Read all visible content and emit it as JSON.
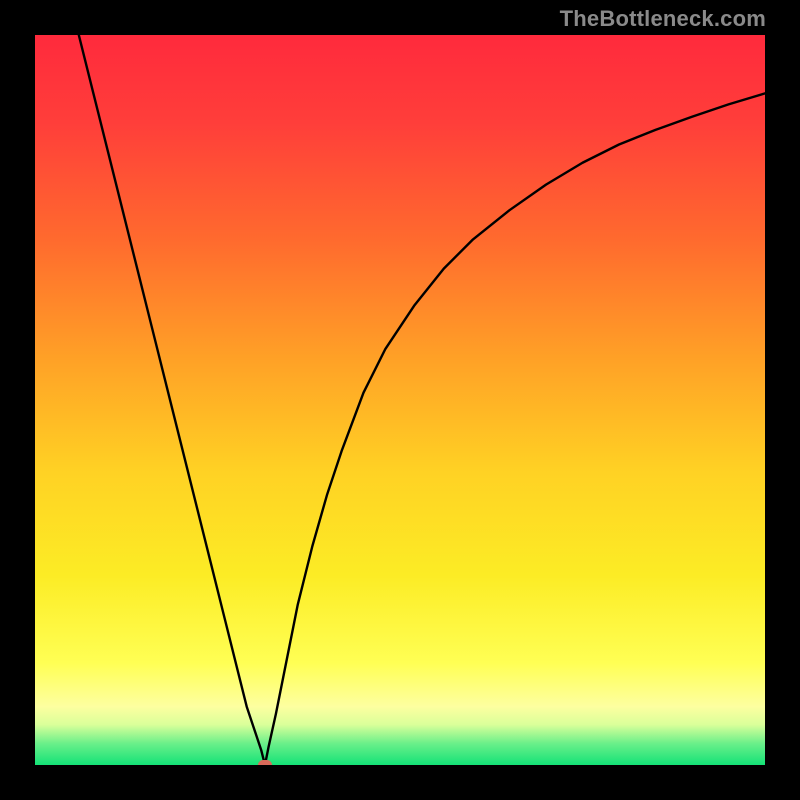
{
  "watermark": "TheBottleneck.com",
  "colors": {
    "background": "#000000",
    "gradient_stops": [
      {
        "offset": 0.0,
        "color": "#ff2a3c"
      },
      {
        "offset": 0.12,
        "color": "#ff3e3a"
      },
      {
        "offset": 0.28,
        "color": "#ff6a2e"
      },
      {
        "offset": 0.45,
        "color": "#ffa326"
      },
      {
        "offset": 0.6,
        "color": "#ffd224"
      },
      {
        "offset": 0.74,
        "color": "#fcec25"
      },
      {
        "offset": 0.86,
        "color": "#ffff54"
      },
      {
        "offset": 0.92,
        "color": "#fdffa0"
      },
      {
        "offset": 0.945,
        "color": "#d9ff9a"
      },
      {
        "offset": 0.97,
        "color": "#6cf08a"
      },
      {
        "offset": 1.0,
        "color": "#14e277"
      }
    ],
    "curve": "#000000",
    "marker": "#d86a5a"
  },
  "chart_data": {
    "type": "line",
    "title": "",
    "xlabel": "",
    "ylabel": "",
    "x_range": [
      0,
      100
    ],
    "y_range": [
      0,
      100
    ],
    "marker": {
      "x": 31.5,
      "y": 0,
      "shape": "rounded-rect"
    },
    "series": [
      {
        "name": "bottleneck-curve",
        "x": [
          6,
          8,
          10,
          12,
          14,
          16,
          18,
          20,
          22,
          24,
          26,
          28,
          29,
          30,
          31,
          31.5,
          32,
          33,
          34,
          36,
          38,
          40,
          42,
          45,
          48,
          52,
          56,
          60,
          65,
          70,
          75,
          80,
          85,
          90,
          95,
          100
        ],
        "y": [
          100,
          92,
          84,
          76,
          68,
          60,
          52,
          44,
          36,
          28,
          20,
          12,
          8,
          5,
          2,
          0,
          2.5,
          7,
          12,
          22,
          30,
          37,
          43,
          51,
          57,
          63,
          68,
          72,
          76,
          79.5,
          82.5,
          85,
          87,
          88.8,
          90.5,
          92
        ]
      }
    ]
  }
}
